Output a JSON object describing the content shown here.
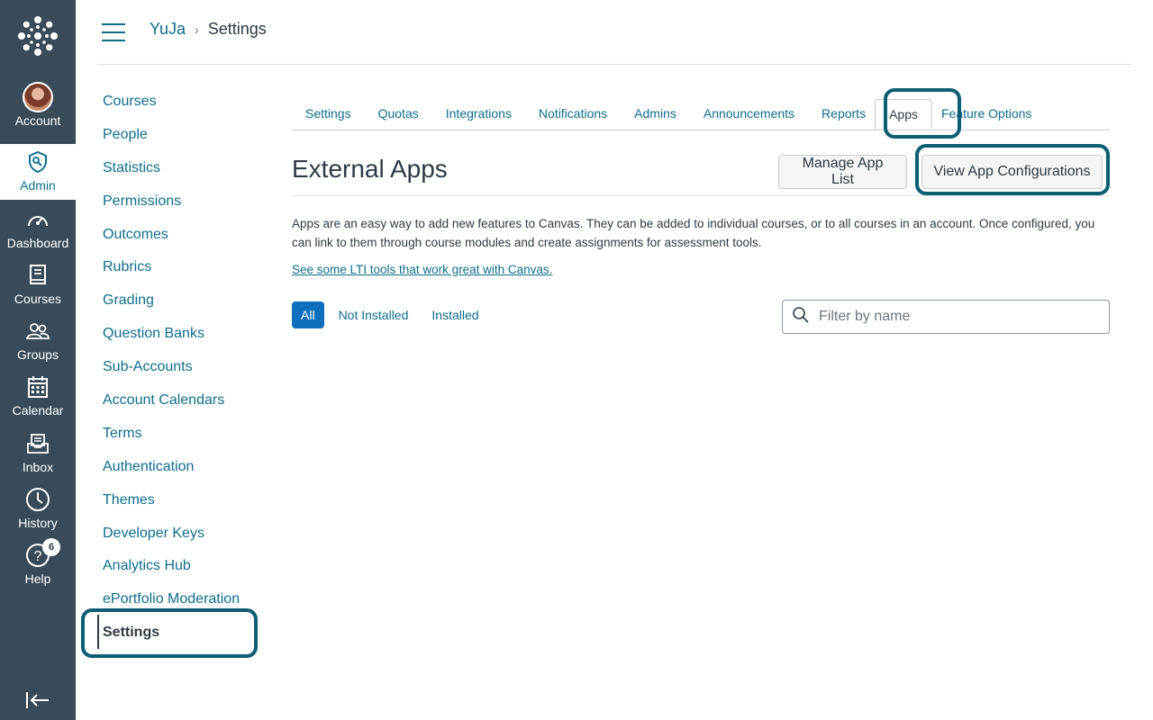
{
  "global_nav": {
    "items": [
      {
        "label": "Account",
        "icon": "avatar"
      },
      {
        "label": "Admin",
        "icon": "shield-icon"
      },
      {
        "label": "Dashboard",
        "icon": "dashboard-icon"
      },
      {
        "label": "Courses",
        "icon": "book-icon"
      },
      {
        "label": "Groups",
        "icon": "groups-icon"
      },
      {
        "label": "Calendar",
        "icon": "calendar-icon"
      },
      {
        "label": "Inbox",
        "icon": "inbox-icon"
      },
      {
        "label": "History",
        "icon": "clock-icon"
      },
      {
        "label": "Help",
        "icon": "help-icon"
      }
    ],
    "help_badge": "6",
    "active": "Admin"
  },
  "breadcrumb": {
    "root": "YuJa",
    "separator": "›",
    "current": "Settings"
  },
  "sidebar": {
    "items": [
      {
        "label": "Courses"
      },
      {
        "label": "People"
      },
      {
        "label": "Statistics"
      },
      {
        "label": "Permissions"
      },
      {
        "label": "Outcomes"
      },
      {
        "label": "Rubrics"
      },
      {
        "label": "Grading"
      },
      {
        "label": "Question Banks"
      },
      {
        "label": "Sub-Accounts"
      },
      {
        "label": "Account Calendars"
      },
      {
        "label": "Terms"
      },
      {
        "label": "Authentication"
      },
      {
        "label": "Themes"
      },
      {
        "label": "Developer Keys"
      },
      {
        "label": "Analytics Hub"
      },
      {
        "label": "ePortfolio Moderation"
      },
      {
        "label": "Settings"
      }
    ],
    "current": "Settings"
  },
  "tabs": [
    {
      "label": "Settings"
    },
    {
      "label": "Quotas"
    },
    {
      "label": "Integrations"
    },
    {
      "label": "Notifications"
    },
    {
      "label": "Admins"
    },
    {
      "label": "Announcements"
    },
    {
      "label": "Reports"
    },
    {
      "label": "Apps"
    },
    {
      "label": "Feature Options"
    }
  ],
  "active_tab": "Apps",
  "main": {
    "title": "External Apps",
    "manage_button": "Manage App List",
    "view_button": "View App Configurations",
    "description": "Apps are an easy way to add new features to Canvas. They can be added to individual courses, or to all courses in an account. Once configured, you can link to them through course modules and create assignments for assessment tools.",
    "lti_link": "See some LTI tools that work great with Canvas.",
    "filters": [
      {
        "label": "All"
      },
      {
        "label": "Not Installed"
      },
      {
        "label": "Installed"
      }
    ],
    "active_filter": "All",
    "search_placeholder": "Filter by name"
  },
  "colors": {
    "nav_bg": "#394b58",
    "link": "#0e6e8c",
    "highlight": "#0c5e73",
    "pill_active": "#0e6fbe"
  }
}
